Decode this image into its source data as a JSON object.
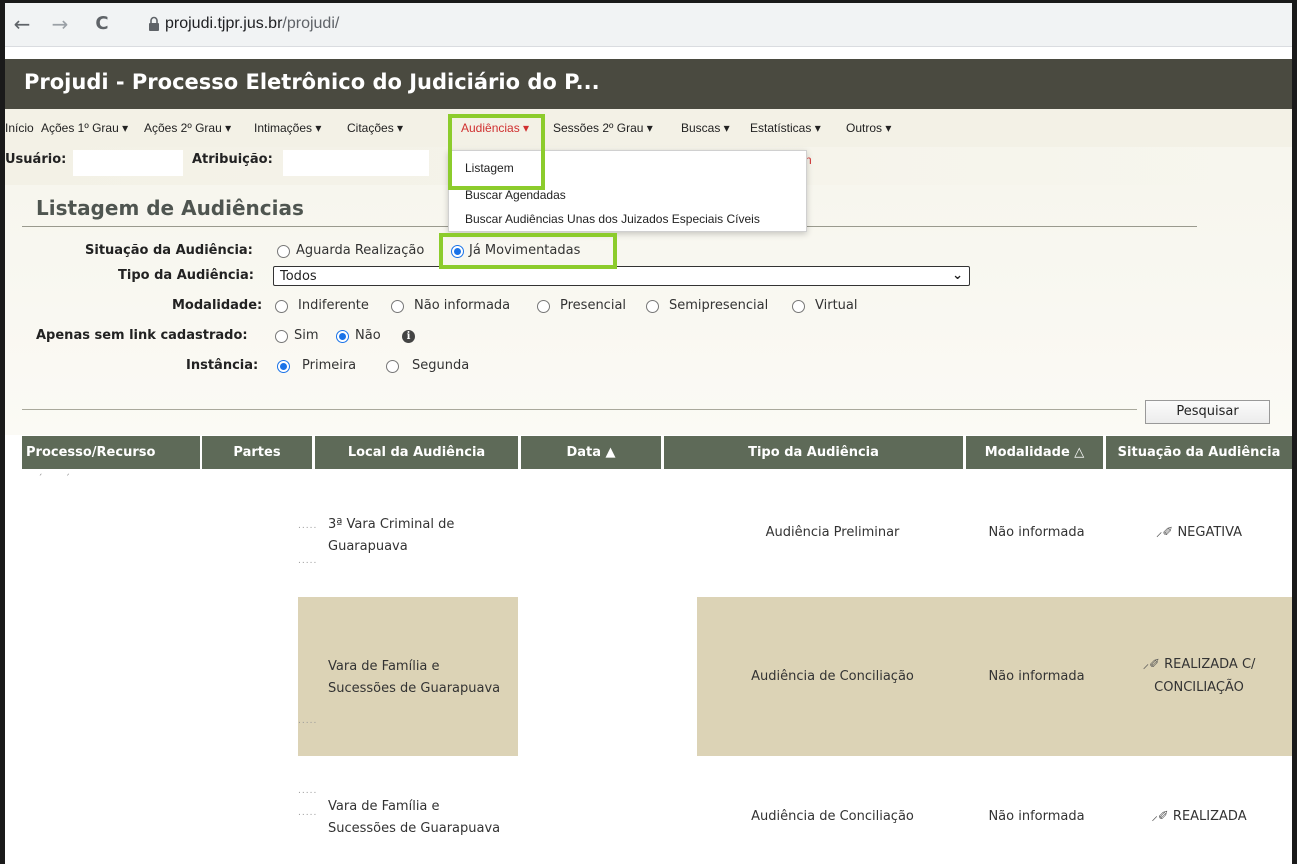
{
  "browser": {
    "back_icon": "←",
    "forward_icon": "→",
    "reload_icon": "C",
    "url_host": "projudi.tjpr.jus.br",
    "url_path": "/projudi/"
  },
  "header": {
    "title": "Projudi - Processo Eletrônico do Judiciário do P..."
  },
  "menu": {
    "items": [
      {
        "label": "Início"
      },
      {
        "label": "Ações 1º Grau ▾"
      },
      {
        "label": "Ações 2º Grau ▾"
      },
      {
        "label": "Intimações ▾"
      },
      {
        "label": "Citações ▾"
      },
      {
        "label": "Audiências ▾"
      },
      {
        "label": "Sessões 2º Grau ▾"
      },
      {
        "label": "Buscas ▾"
      },
      {
        "label": "Estatísticas ▾"
      },
      {
        "label": "Outros ▾"
      }
    ],
    "dropdown": [
      {
        "label": "Listagem"
      },
      {
        "label": "Buscar Agendadas"
      },
      {
        "label": "Buscar Audiências Unas dos Juizados Especiais Cíveis"
      }
    ],
    "stray_fragment": "n"
  },
  "user_row": {
    "usuario_label": "Usuário:",
    "atribuicao_label": "Atribuição:"
  },
  "page_title": "Listagem de Audiências",
  "form": {
    "situacao": {
      "label": "Situação da Audiência:",
      "options": [
        "Aguarda Realização",
        "Já Movimentadas"
      ],
      "selected": "Já Movimentadas"
    },
    "tipo": {
      "label": "Tipo da Audiência:",
      "value": "Todos"
    },
    "modalidade": {
      "label": "Modalidade:",
      "options": [
        "Indiferente",
        "Não informada",
        "Presencial",
        "Semipresencial",
        "Virtual"
      ]
    },
    "sem_link": {
      "label": "Apenas sem link cadastrado:",
      "options": [
        "Sim",
        "Não"
      ],
      "selected": "Não",
      "info_icon": "i"
    },
    "instancia": {
      "label": "Instância:",
      "options": [
        "Primeira",
        "Segunda"
      ],
      "selected": "Primeira"
    },
    "search_button": "Pesquisar"
  },
  "table": {
    "headers": [
      "Processo/Recurso",
      "Partes",
      "Local da Audiência",
      "Data ▲",
      "Tipo da Audiência",
      "Modalidade △",
      "Situação da Audiência"
    ],
    "rows": [
      {
        "local_line1": "3ª Vara Criminal de",
        "local_line2": "Guarapuava",
        "tipo": "Audiência Preliminar",
        "modalidade": "Não informada",
        "situacao_line1": "NEGATIVA",
        "situacao_line2": ""
      },
      {
        "local_line1": "Vara de Família e",
        "local_line2": "Sucessões de Guarapuava",
        "tipo": "Audiência de Conciliação",
        "modalidade": "Não informada",
        "situacao_line1": "REALIZADA C/",
        "situacao_line2": "CONCILIAÇÃO"
      },
      {
        "local_line1": "Vara de Família e",
        "local_line2": "Sucessões de Guarapuava",
        "tipo": "Audiência de Conciliação",
        "modalidade": "Não informada",
        "situacao_line1": "REALIZADA",
        "situacao_line2": ""
      }
    ]
  },
  "colors": {
    "header_bg": "#4a4a40",
    "table_header_bg": "#5e6a58",
    "row_highlight": "#dcd3b6",
    "highlight_border": "#8ccc2c",
    "active_menu": "#d03030"
  }
}
